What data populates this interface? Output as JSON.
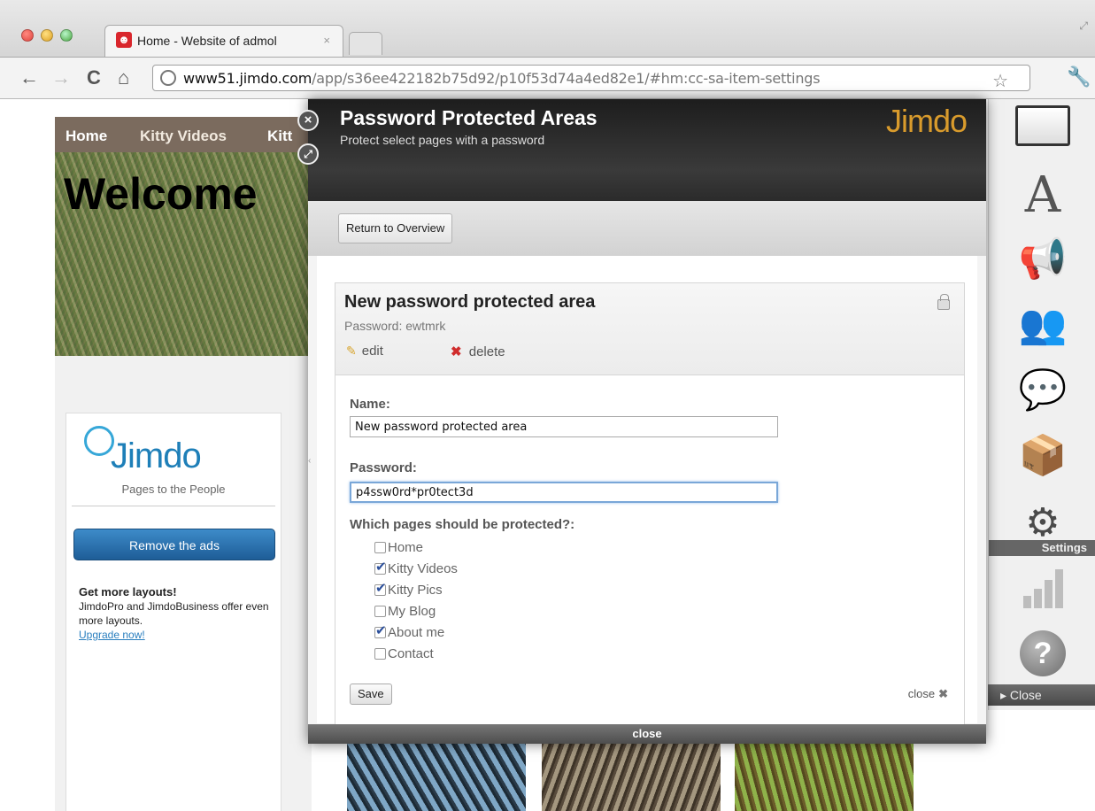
{
  "browser": {
    "tab_title": "Home - Website of admol",
    "tab_close": "×",
    "url_host": "www51.jimdo.com",
    "url_path": "/app/s36ee422182b75d92/p10f53d74a4ed82e1/#hm:cc-sa-item-settings"
  },
  "site": {
    "nav": [
      "Home",
      "Kitty Videos",
      "Kitt"
    ],
    "headline": "Welcome",
    "logo": "Jimdo",
    "tagline": "Pages to the People",
    "remove_ads": "Remove the ads",
    "more_layouts_title": "Get more layouts!",
    "more_layouts_text": "JimdoPro and JimdoBusiness offer even more layouts.",
    "upgrade_link": "Upgrade now!"
  },
  "dialog": {
    "title": "Password Protected Areas",
    "subtitle": "Protect select pages with a password",
    "brand": "Jimdo",
    "return_button": "Return to Overview",
    "area": {
      "name": "New password protected area",
      "password_line": "Password: ewtmrk",
      "edit": "edit",
      "delete": "delete"
    },
    "form": {
      "name_label": "Name:",
      "name_value": "New password protected area",
      "password_label": "Password:",
      "password_value": "p4ssw0rd*pr0tect3d",
      "pages_label": "Which pages should be protected?:",
      "pages": [
        {
          "label": "Home",
          "checked": false
        },
        {
          "label": "Kitty Videos",
          "checked": true
        },
        {
          "label": "Kitty Pics",
          "checked": true
        },
        {
          "label": "My Blog",
          "checked": false
        },
        {
          "label": "About me",
          "checked": true
        },
        {
          "label": "Contact",
          "checked": false
        }
      ],
      "save": "Save",
      "close": "close"
    },
    "footer_close": "close"
  },
  "rail": {
    "settings_label": "Settings",
    "close_label": "Close",
    "icons": [
      "layout-icon",
      "style-icon",
      "promotion-icon",
      "users-icon",
      "chat-icon",
      "store-icon",
      "settings-icon",
      "stats-icon",
      "help-icon"
    ]
  }
}
